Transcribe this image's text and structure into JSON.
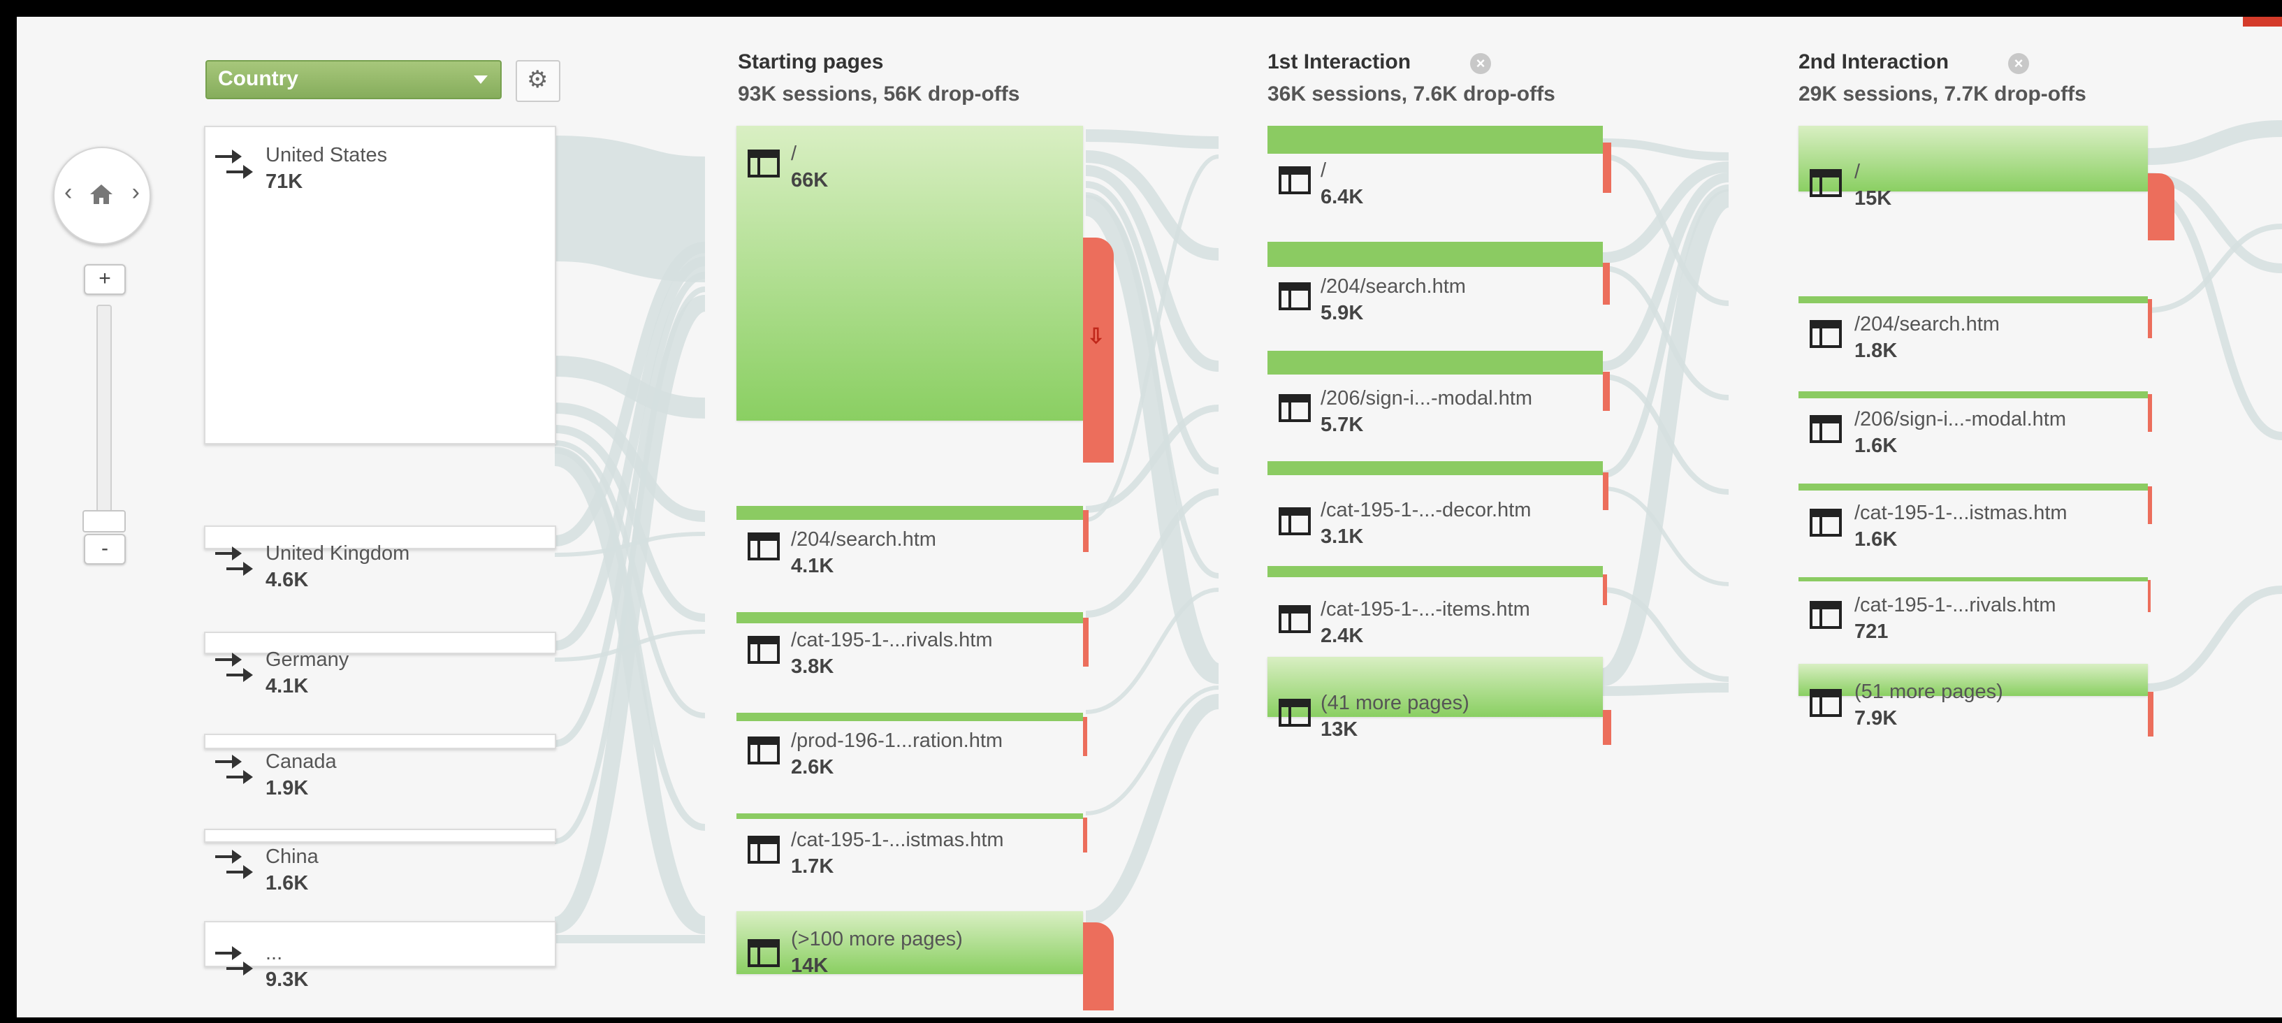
{
  "toolbar": {
    "dimension_select": "Country"
  },
  "columns": [
    {
      "title": "Starting pages",
      "subtitle": "93K sessions, 56K drop-offs"
    },
    {
      "title": "1st Interaction",
      "subtitle": "36K sessions, 7.6K drop-offs"
    },
    {
      "title": "2nd Interaction",
      "subtitle": "29K sessions, 7.7K drop-offs"
    }
  ],
  "icons": {
    "nav_home": "home-icon",
    "settings": "gear-icon",
    "country": "arrows-icon",
    "page": "page-layout-icon",
    "close": "close-icon",
    "dropoff": "down-arrow-icon"
  },
  "colors": {
    "node_green": "#8bcb62",
    "dropoff_red": "#ec6e5c",
    "dimension_green": "#8fb565",
    "flow_gray": "#d5dfdf"
  },
  "zoom": {
    "plus": "+",
    "minus": "-"
  },
  "countries": [
    {
      "name": "United States",
      "value": "71K"
    },
    {
      "name": "United Kingdom",
      "value": "4.6K"
    },
    {
      "name": "Germany",
      "value": "4.1K"
    },
    {
      "name": "Canada",
      "value": "1.9K"
    },
    {
      "name": "China",
      "value": "1.6K"
    },
    {
      "name": "...",
      "value": "9.3K"
    }
  ],
  "starting_pages": [
    {
      "name": "/",
      "value": "66K"
    },
    {
      "name": "/204/search.htm",
      "value": "4.1K"
    },
    {
      "name": "/cat-195-1-...rivals.htm",
      "value": "3.8K"
    },
    {
      "name": "/prod-196-1...ration.htm",
      "value": "2.6K"
    },
    {
      "name": "/cat-195-1-...istmas.htm",
      "value": "1.7K"
    },
    {
      "name": "(>100 more pages)",
      "value": "14K"
    }
  ],
  "first_interaction": [
    {
      "name": "/",
      "value": "6.4K"
    },
    {
      "name": "/204/search.htm",
      "value": "5.9K"
    },
    {
      "name": "/206/sign-i...-modal.htm",
      "value": "5.7K"
    },
    {
      "name": "/cat-195-1-...-decor.htm",
      "value": "3.1K"
    },
    {
      "name": "/cat-195-1-...-items.htm",
      "value": "2.4K"
    },
    {
      "name": "(41 more pages)",
      "value": "13K"
    }
  ],
  "second_interaction": [
    {
      "name": "/",
      "value": "15K"
    },
    {
      "name": "/204/search.htm",
      "value": "1.8K"
    },
    {
      "name": "/206/sign-i...-modal.htm",
      "value": "1.6K"
    },
    {
      "name": "/cat-195-1-...istmas.htm",
      "value": "1.6K"
    },
    {
      "name": "/cat-195-1-...rivals.htm",
      "value": "721"
    },
    {
      "name": "(51 more pages)",
      "value": "7.9K"
    }
  ]
}
